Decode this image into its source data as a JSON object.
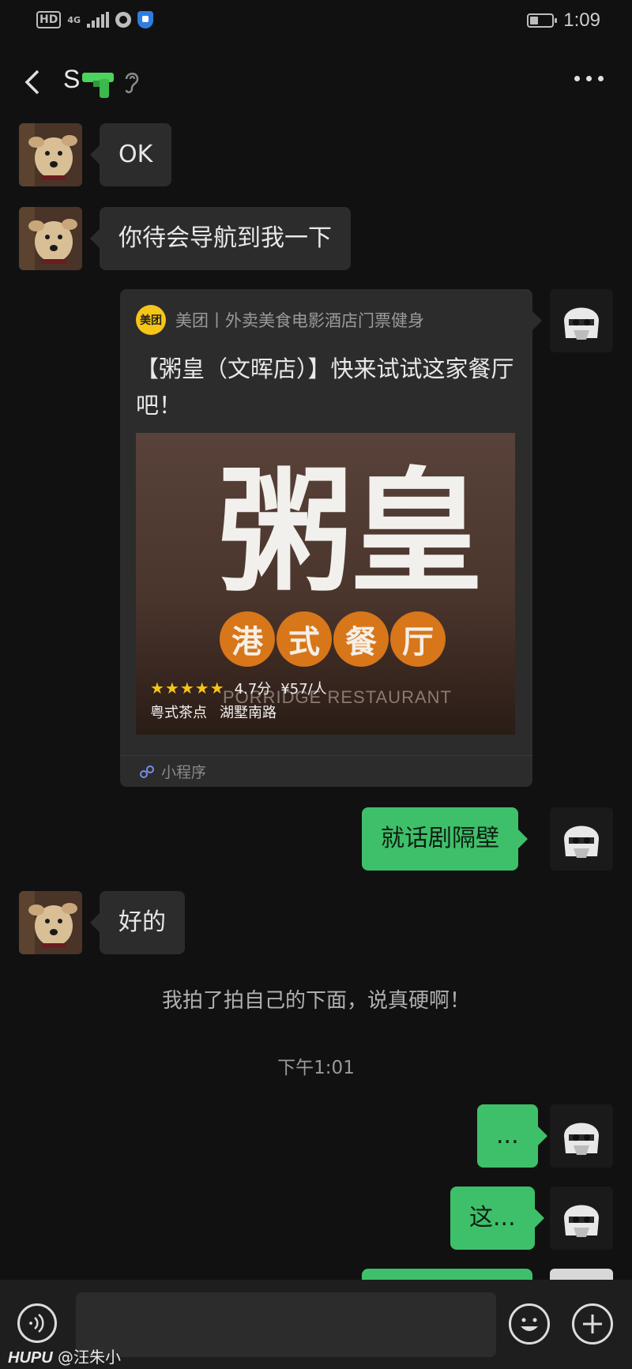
{
  "status_bar": {
    "hd": "HD",
    "network": "4G",
    "time": "1:09"
  },
  "chat": {
    "title": "S"
  },
  "messages": {
    "m1": "OK",
    "m2": "你待会导航到我一下",
    "m4": "就话剧隔壁",
    "m5": "好的",
    "m6": "...",
    "m7": "这..."
  },
  "mini_program": {
    "logo_text": "美团",
    "source": "美团丨外卖美食电影酒店门票健身",
    "title": "【粥皇（文晖店）】快来试试这家餐厅吧！",
    "image": {
      "brand_big": "粥皇",
      "brand_sub": [
        "港",
        "式",
        "餐",
        "厅"
      ],
      "brand_en": "PORRIDGE RESTAURANT",
      "stars": "★★★★★",
      "rating": "4.7分",
      "price": "¥57/人",
      "category": "粤式茶点",
      "location": "湖墅南路"
    },
    "footer": "小程序"
  },
  "system_message": "我拍了拍自己的下面，说真硬啊！",
  "timestamp": "下午1:01",
  "watermark": {
    "brand": "HUPU",
    "user": "@汪朱小"
  },
  "colors": {
    "outgoing": "#3ec06a",
    "incoming": "#2c2c2c",
    "background": "#111111"
  }
}
